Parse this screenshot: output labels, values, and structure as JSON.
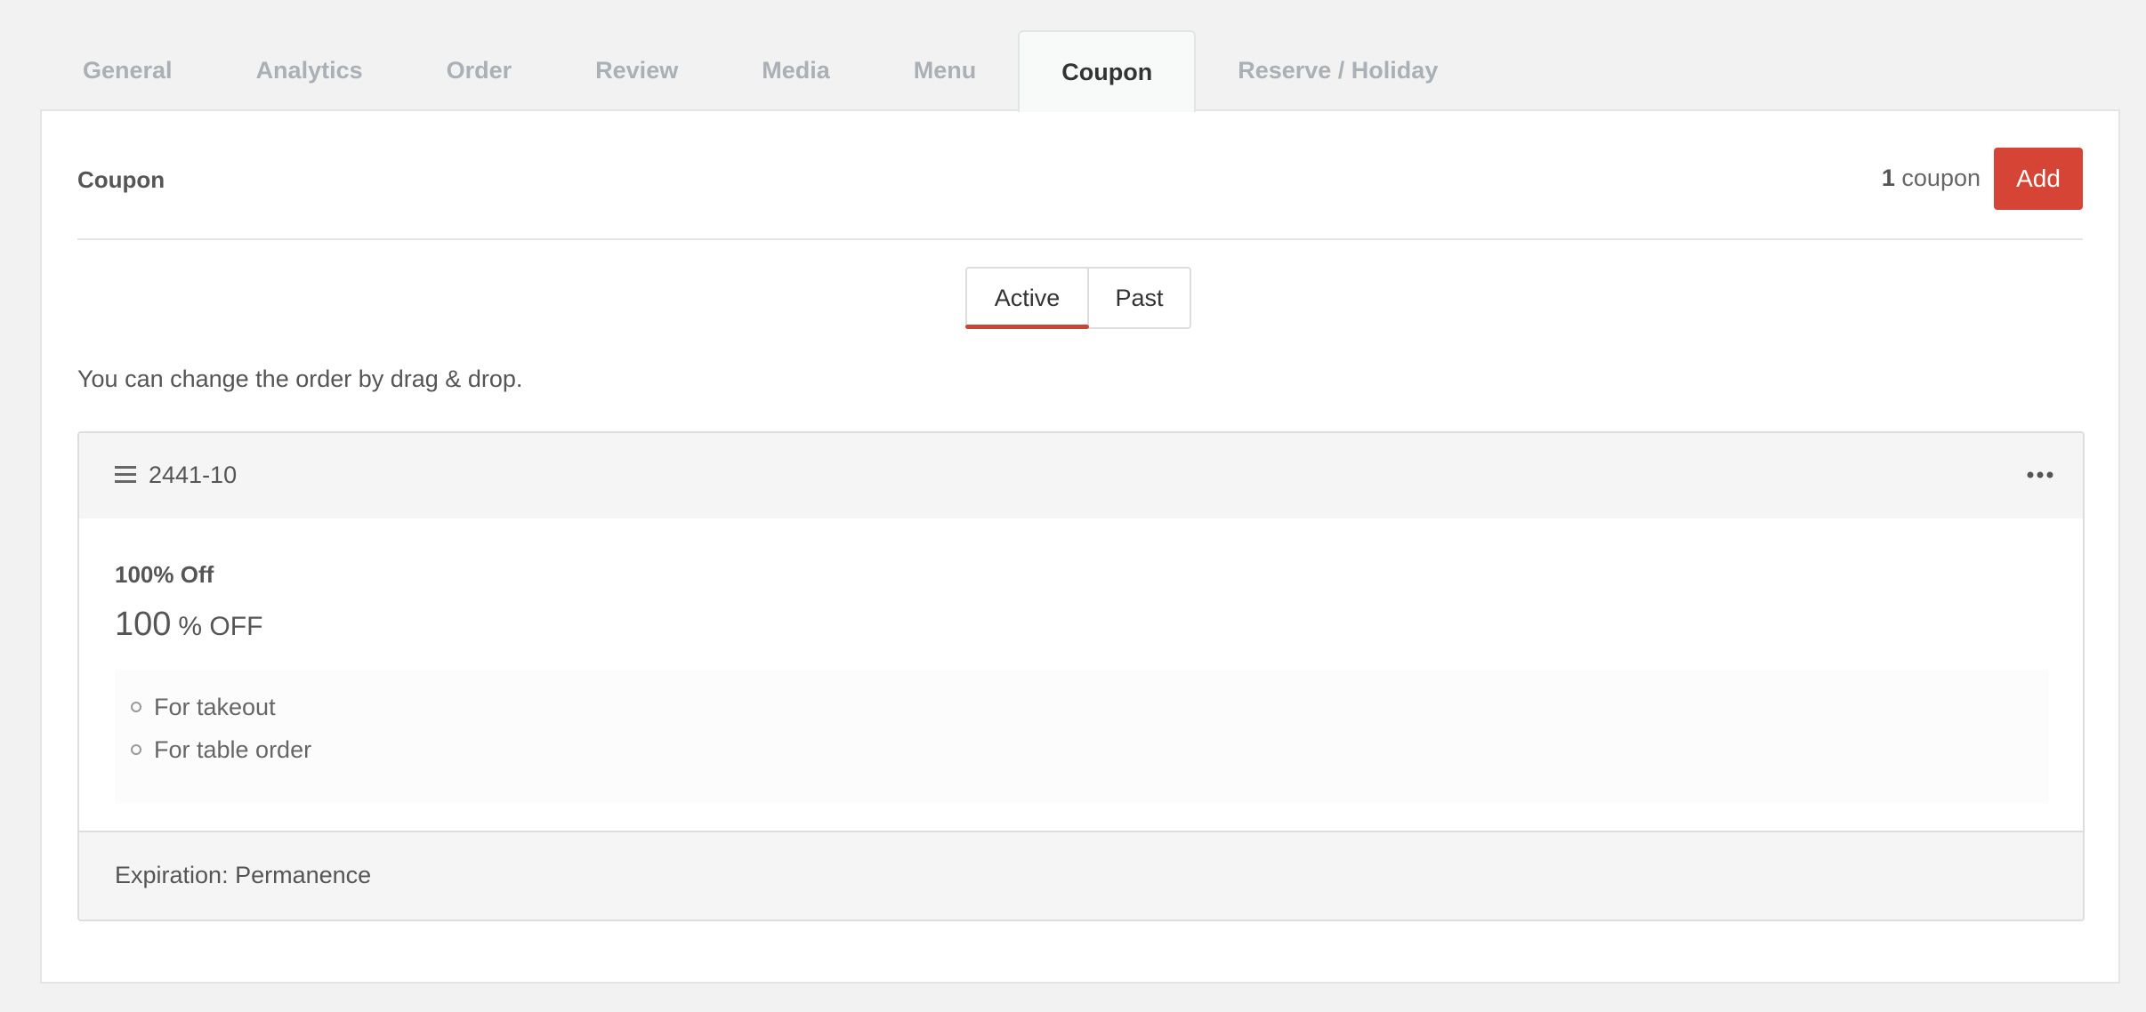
{
  "tabs": [
    {
      "label": "General",
      "active": false
    },
    {
      "label": "Analytics",
      "active": false
    },
    {
      "label": "Order",
      "active": false
    },
    {
      "label": "Review",
      "active": false
    },
    {
      "label": "Media",
      "active": false
    },
    {
      "label": "Menu",
      "active": false
    },
    {
      "label": "Coupon",
      "active": true
    },
    {
      "label": "Reserve / Holiday",
      "active": false
    }
  ],
  "panel": {
    "title": "Coupon",
    "count_number": "1",
    "count_label": "coupon",
    "add_label": "Add"
  },
  "filter": {
    "active_label": "Active",
    "past_label": "Past",
    "selected": "Active"
  },
  "hint": "You can change the order by drag & drop.",
  "coupon": {
    "code": "2441-10",
    "name": "100% Off",
    "discount_value": "100",
    "discount_unit": "% OFF",
    "conditions": [
      "For takeout",
      "For table order"
    ],
    "expiration": "Expiration: Permanence"
  },
  "colors": {
    "accent": "#d64435",
    "active_underline": "#c9453a",
    "page_bg": "#f1f2f1"
  },
  "icons": {
    "drag": "drag-handle-icon",
    "more": "more-horizontal-icon"
  }
}
